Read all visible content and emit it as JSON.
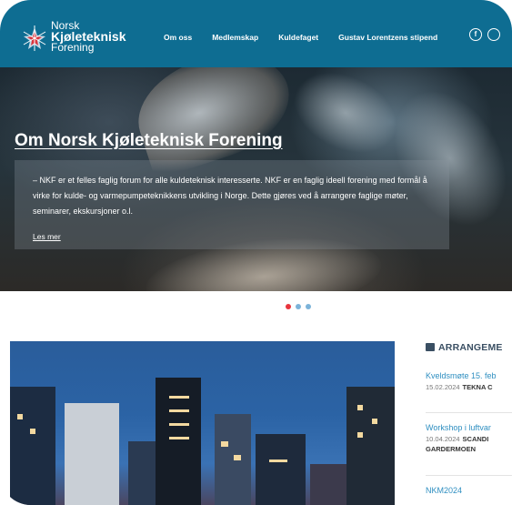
{
  "header": {
    "logo": {
      "line1": "Norsk",
      "line2": "Kjøleteknisk",
      "line3": "Forening"
    },
    "nav": [
      {
        "label": "Om oss"
      },
      {
        "label": "Medlemskap"
      },
      {
        "label": "Kuldefaget"
      },
      {
        "label": "Gustav Lorentzens stipend"
      }
    ],
    "social": [
      {
        "icon": "facebook-icon",
        "glyph": "f"
      },
      {
        "icon": "linkedin-icon",
        "glyph": ""
      }
    ],
    "background_color": "#0e6d92"
  },
  "hero": {
    "title": "Om Norsk Kjøleteknisk Forening",
    "description": "– NKF er et felles faglig forum for alle kuldeteknisk interesserte. NKF er en faglig ideell forening med formål å virke for kulde- og varmepumpeteknikkens utvikling i Norge. Dette gjøres ved å arrangere faglige møter, seminarer, ekskursjoner o.l.",
    "link": "Les mer"
  },
  "carousel": {
    "active_index": 0,
    "dot_colors": [
      "#e8343d",
      "#7cb3d9",
      "#7cb3d9"
    ]
  },
  "events": {
    "title": "ARRANGEME",
    "items": [
      {
        "name": "Kveldsmøte 15. feb",
        "date": "15.02.2024",
        "location": "TEKNA C",
        "location2": ""
      },
      {
        "name": "Workshop i luftvar",
        "date": "10.04.2024",
        "location": "SCANDI",
        "location2": "GARDERMOEN"
      },
      {
        "name": "NKM2024",
        "date": "",
        "location": "",
        "location2": ""
      }
    ],
    "accent_color": "#2f8fc1"
  }
}
